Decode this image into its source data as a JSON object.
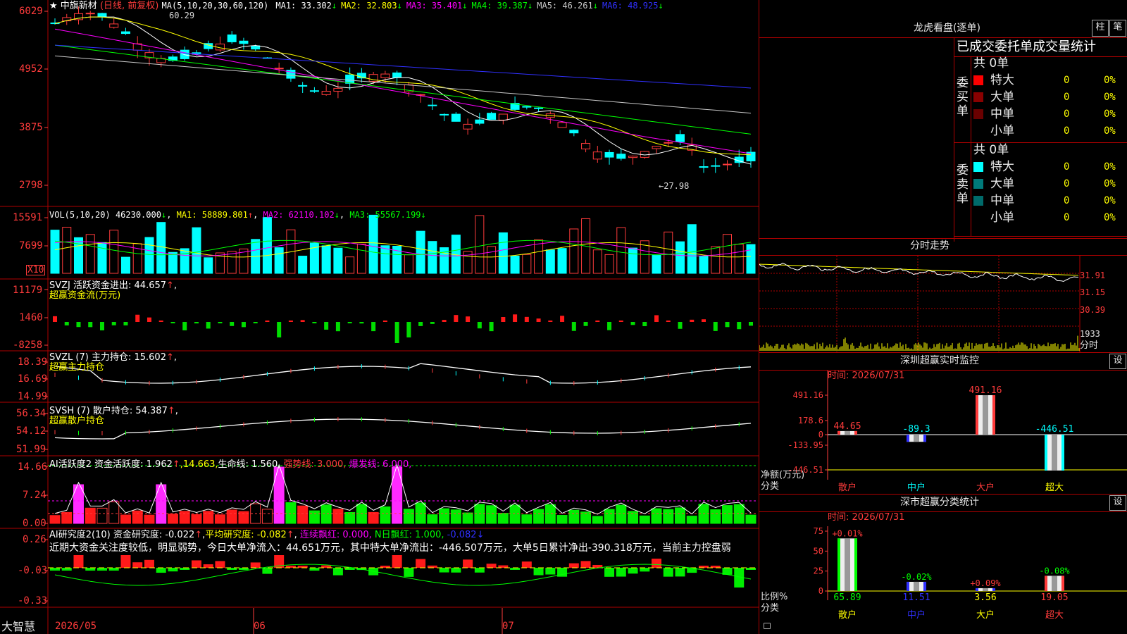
{
  "main": {
    "stock_name": "中旗新材",
    "period_label": "(日线, 前复权)",
    "ma_header": "MA(5,10,20,30,60,120)",
    "ma": [
      {
        "label": "MA1: 33.302",
        "arrow": "↓",
        "color": "#ffffff"
      },
      {
        "label": "MA2: 32.803",
        "arrow": "↓",
        "color": "#ffff00"
      },
      {
        "label": "MA3: 35.401",
        "arrow": "↓",
        "color": "#ff00ff"
      },
      {
        "label": "MA4: 39.387",
        "arrow": "↓",
        "color": "#00ff00"
      },
      {
        "label": "MA5: 46.261",
        "arrow": "↓",
        "color": "#c8c8c8"
      },
      {
        "label": "MA6: 48.925",
        "arrow": "↓",
        "color": "#3030ff"
      }
    ],
    "y_ticks": [
      "6029",
      "4952",
      "3875",
      "2798"
    ],
    "high_label": "60.29",
    "low_label": "←27.98",
    "candles_note": "daily candlesticks"
  },
  "volume": {
    "header": "VOL(5,10,20)",
    "value": "46230.000",
    "value_arrow": "↓",
    "ma1": "MA1: 58889.801",
    "ma1_arrow": "↑",
    "ma2": "MA2: 62110.102",
    "ma2_arrow": "↓",
    "ma3": "MA3: 55567.199",
    "ma3_arrow": "↓",
    "y_ticks": [
      "15591",
      "7699"
    ],
    "unit": "X10"
  },
  "svzj": {
    "header": "SVZJ  活跃资金进出: 44.657",
    "arrow": "↑",
    "suffix": ",",
    "sub": "超赢资金流(万元)",
    "y_ticks": [
      "11179",
      "1460",
      "-8258"
    ]
  },
  "svzl": {
    "header": "SVZL (7) 主力持仓: 15.602",
    "arrow": "↑",
    "suffix": ",",
    "sub": "超赢主力持仓",
    "y_ticks": [
      "18.39",
      "16.69",
      "14.99"
    ]
  },
  "svsh": {
    "header": "SVSH (7) 散户持仓: 54.387",
    "arrow": "↑",
    "suffix": ",",
    "sub": "超赢散户持仓",
    "y_ticks": [
      "56.34",
      "54.12",
      "51.99"
    ]
  },
  "ai1": {
    "header": "AI活跃度2 资金活跃度: 1.962",
    "arrow": "↑",
    "v2": ",14.663,",
    "v3": "生命线: 1.560,",
    "v4": "强势线: 3.000,",
    "v5": "爆发线: 6.000,",
    "y_ticks": [
      "14.66",
      "7.24",
      "0.00"
    ]
  },
  "ai2": {
    "header": "AI研究度2(10) 资金研究度: -0.022",
    "arrow1": "↑",
    "avg": "平均研究度: -0.082",
    "arrow2": "↑",
    "lianxu": "连续飘红: 0.000,",
    "nri": "N日飘红: 1.000,",
    "last": "-0.082",
    "arrow3": "↓",
    "comment": "近期大资金关注度较低，明显弱势，今日大单净流入：44.651万元，其中特大单净流出：-446.507万元，大单5日累计净出-390.318万元，当前主力控盘弱",
    "y_ticks": [
      "0.26",
      "-0.03",
      "-0.33"
    ]
  },
  "bottom": {
    "brand": "大智慧",
    "dates": [
      "2026/05",
      "06",
      "07"
    ]
  },
  "right": {
    "lhb_title": "龙虎看盘(逐单)",
    "btn_zhu": "柱",
    "btn_bi": "笔",
    "stats_title": "已成交委托单成交量统计",
    "buy_label": "委买单",
    "sell_label": "委卖单",
    "buy_total": "共 0单",
    "sell_total": "共 0单",
    "buy_rows": [
      {
        "name": "特大",
        "count": "0",
        "pct": "0%",
        "color": "#ff0000"
      },
      {
        "name": "大单",
        "count": "0",
        "pct": "0%",
        "color": "#8a0000"
      },
      {
        "name": "中单",
        "count": "0",
        "pct": "0%",
        "color": "#6a0000"
      },
      {
        "name": "小单",
        "count": "0",
        "pct": "0%",
        "color": "#000000"
      }
    ],
    "sell_rows": [
      {
        "name": "特大",
        "count": "0",
        "pct": "0%",
        "color": "#00ffff"
      },
      {
        "name": "大单",
        "count": "0",
        "pct": "0%",
        "color": "#007a7a"
      },
      {
        "name": "中单",
        "count": "0",
        "pct": "0%",
        "color": "#006a6a"
      },
      {
        "name": "小单",
        "count": "0",
        "pct": "0%",
        "color": "#000000"
      }
    ],
    "intraday_title": "分时走势",
    "intraday_y": [
      "31.91",
      "31.15",
      "30.39"
    ],
    "intraday_vol": "1933",
    "intraday_fen": "分时",
    "monitor_title": "深圳超赢实时监控",
    "monitor_btn": "设",
    "monitor_time": "时间: 2026/07/31",
    "monitor_y": [
      "491.16",
      "178.6",
      "0",
      "-133.95",
      "-446.51"
    ],
    "monitor_unit": "净额(万元)",
    "monitor_cat": "分类",
    "monitor_bars": [
      {
        "name": "散户",
        "value": "44.65"
      },
      {
        "name": "中户",
        "value": "-89.3"
      },
      {
        "name": "大户",
        "value": "491.16"
      },
      {
        "name": "超大",
        "value": "-446.51"
      }
    ],
    "class_title": "深市超赢分类统计",
    "class_btn": "设",
    "class_time": "时间: 2026/07/31",
    "class_y": [
      "75",
      "50",
      "25",
      "0"
    ],
    "class_unit": "比例%",
    "class_cat": "分类",
    "class_bars": [
      {
        "name": "散户",
        "value": "65.89",
        "change": "+0.01%"
      },
      {
        "name": "中户",
        "value": "11.51",
        "change": "-0.02%"
      },
      {
        "name": "大户",
        "value": "3.56",
        "change": "+0.09%"
      },
      {
        "name": "超大",
        "value": "19.05",
        "change": "-0.08%"
      }
    ]
  }
}
